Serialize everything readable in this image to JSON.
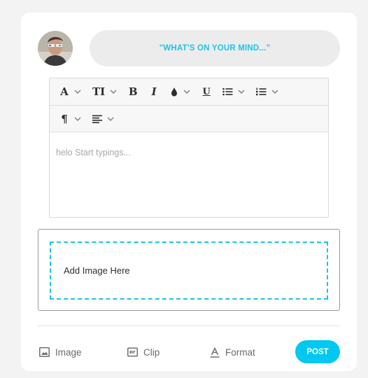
{
  "composer": {
    "prompt": "\"WHAT'S ON YOUR MIND...\""
  },
  "editor": {
    "toolbar": [
      {
        "name": "font-icon",
        "glyph": "A"
      },
      {
        "name": "text-size-icon",
        "glyph": "TI"
      },
      {
        "name": "bold-icon",
        "glyph": "B"
      },
      {
        "name": "italic-icon",
        "glyph": "I"
      },
      {
        "name": "text-color-icon",
        "glyph": ""
      },
      {
        "name": "underline-icon",
        "glyph": "U"
      },
      {
        "name": "bullet-list-icon",
        "glyph": ""
      },
      {
        "name": "numbered-list-icon",
        "glyph": ""
      },
      {
        "name": "paragraph-icon",
        "glyph": "¶"
      },
      {
        "name": "align-icon",
        "glyph": ""
      }
    ],
    "content": "helo Start typings..."
  },
  "upload": {
    "label": "Add Image Here"
  },
  "actions": {
    "image_label": "Image",
    "clip_label": "Clip",
    "format_label": "Format",
    "post_label": "POST"
  },
  "colors": {
    "accent": "#1ec3e6",
    "post_button": "#00c8f0"
  }
}
